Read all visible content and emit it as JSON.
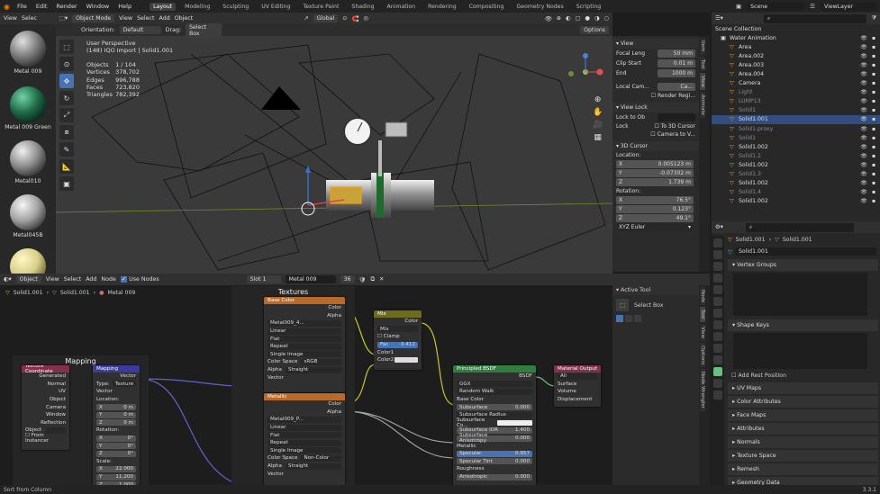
{
  "topbar": {
    "menus": [
      "File",
      "Edit",
      "Render",
      "Window",
      "Help"
    ],
    "workspaces": [
      "Layout",
      "Modeling",
      "Sculpting",
      "UV Editing",
      "Texture Paint",
      "Shading",
      "Animation",
      "Rendering",
      "Compositing",
      "Geometry Nodes",
      "Scripting"
    ],
    "active_workspace": "Layout",
    "scene": "Scene",
    "view_layer": "ViewLayer"
  },
  "assets": [
    {
      "name": "Metal 009",
      "color": "#9a9a9a"
    },
    {
      "name": "Metal 009 Green",
      "color": "#1f6b4a"
    },
    {
      "name": "Metal010",
      "color": "#8c8c8c"
    },
    {
      "name": "Metal045B",
      "color": "#a3a3a3"
    },
    {
      "name": "",
      "color": "#d8d08a"
    }
  ],
  "asset_header": {
    "view": "View",
    "select": "Selec"
  },
  "viewport": {
    "mode": "Object Mode",
    "menus": [
      "View",
      "Select",
      "Add",
      "Object"
    ],
    "orientation_label": "Orientation:",
    "orientation": "Default",
    "drag_label": "Drag:",
    "drag": "Select Box",
    "transform": "Global",
    "options": "Options",
    "perspective": "User Perspective",
    "context": "(148) IQO Import | Solid1.001",
    "stats": [
      {
        "k": "Objects",
        "v": "1 / 104"
      },
      {
        "k": "Vertices",
        "v": "378,702"
      },
      {
        "k": "Edges",
        "v": "996,788"
      },
      {
        "k": "Faces",
        "v": "723,820"
      },
      {
        "k": "Triangles",
        "v": "782,392"
      }
    ]
  },
  "npanel": {
    "view_title": "View",
    "focal_label": "Focal Leng",
    "focal": "50 mm",
    "clip_label": "Clip Start",
    "clip_start": "0.01 m",
    "end_label": "End",
    "clip_end": "1000 m",
    "local_cam": "Local Cam...",
    "cam_btn": "Ca...",
    "render_region": "Render Regi...",
    "view_lock_title": "View Lock",
    "lock_to_obj": "Lock to Ob",
    "lock_label": "Lock",
    "to_3d_cursor": "To 3D Cursor",
    "camera_to_view": "Camera to V...",
    "cursor_title": "3D Cursor",
    "location_label": "Location:",
    "loc": [
      {
        "a": "X",
        "v": "0.005123 m"
      },
      {
        "a": "Y",
        "v": "-0.07302 m"
      },
      {
        "a": "Z",
        "v": "1.739 m"
      }
    ],
    "rotation_label": "Rotation:",
    "rot": [
      {
        "a": "X",
        "v": "76.5°"
      },
      {
        "a": "Y",
        "v": "0.123°"
      },
      {
        "a": "Z",
        "v": "49.1°"
      }
    ],
    "euler": "XYZ Euler"
  },
  "vtabs": [
    "Item",
    "Tool",
    "View",
    "Animate"
  ],
  "outliner": {
    "collection": "Scene Collection",
    "rows": [
      {
        "name": "Water Animation",
        "sel": false,
        "dim": false
      },
      {
        "name": "Area",
        "sel": false,
        "dim": false
      },
      {
        "name": "Area.002",
        "sel": false,
        "dim": false
      },
      {
        "name": "Area.003",
        "sel": false,
        "dim": false
      },
      {
        "name": "Area.004",
        "sel": false,
        "dim": false
      },
      {
        "name": "Camera",
        "sel": false,
        "dim": false
      },
      {
        "name": "Light",
        "sel": false,
        "dim": true
      },
      {
        "name": "LUMP13",
        "sel": false,
        "dim": true
      },
      {
        "name": "Solid1",
        "sel": false,
        "dim": true
      },
      {
        "name": "Solid1.001",
        "sel": true,
        "dim": false
      },
      {
        "name": "Solid1.proxy",
        "sel": false,
        "dim": true
      },
      {
        "name": "Solid1",
        "sel": false,
        "dim": true
      },
      {
        "name": "Solid1.002",
        "sel": false,
        "dim": false
      },
      {
        "name": "Solid1.2",
        "sel": false,
        "dim": true
      },
      {
        "name": "Solid1.002",
        "sel": false,
        "dim": false
      },
      {
        "name": "Solid1.3",
        "sel": false,
        "dim": true
      },
      {
        "name": "Solid1.002",
        "sel": false,
        "dim": false
      },
      {
        "name": "Solid1.4",
        "sel": false,
        "dim": true
      },
      {
        "name": "Solid1.002",
        "sel": false,
        "dim": false
      }
    ]
  },
  "props": {
    "breadcrumb_a": "Solid1.001",
    "breadcrumb_b": "Solid1.001",
    "mesh_name": "Solid1.001",
    "vertex_groups": "Vertex Groups",
    "shape_keys": "Shape Keys",
    "add_rest": "Add Rest Position",
    "sections": [
      "UV Maps",
      "Color Attributes",
      "Face Maps",
      "Attributes",
      "Normals",
      "Texture Space",
      "Remesh",
      "Geometry Data"
    ]
  },
  "node_editor": {
    "type": "Object",
    "menus": [
      "View",
      "Select",
      "Add",
      "Node"
    ],
    "use_nodes": "Use Nodes",
    "slot": "Slot 1",
    "material": "Metal 009",
    "users": "36",
    "breadcrumb": [
      "Solid1.001",
      "Solid1.001",
      "Metal 009"
    ],
    "frame_mapping": "Mapping",
    "frame_textures": "Textures",
    "tex_coord": {
      "title": "Texture Coordinate",
      "outs": [
        "Generated",
        "Normal",
        "UV",
        "Object",
        "Camera",
        "Window",
        "Reflection"
      ],
      "object": "Object",
      "from_instancer": "From Instancer"
    },
    "mapping": {
      "title": "Mapping",
      "vector": "Vector",
      "type_label": "Type:",
      "type": "Texture",
      "vec_in": "Vector",
      "location": "Location:",
      "loc": [
        {
          "a": "X",
          "v": "0 m"
        },
        {
          "a": "Y",
          "v": "0 m"
        },
        {
          "a": "Z",
          "v": "0 m"
        }
      ],
      "rotation": "Rotation:",
      "rot": [
        {
          "a": "X",
          "v": "0°"
        },
        {
          "a": "Y",
          "v": "0°"
        },
        {
          "a": "Z",
          "v": "0°"
        }
      ],
      "scale": "Scale:",
      "scl": [
        {
          "a": "X",
          "v": "22.000"
        },
        {
          "a": "Y",
          "v": "11.200"
        },
        {
          "a": "Z",
          "v": "1.000"
        }
      ]
    },
    "base_color": {
      "title": "Base Color",
      "color": "Color",
      "alpha": "Alpha",
      "image": "Metal009_4...",
      "interp": "Linear",
      "proj": "Flat",
      "ext": "Repeat",
      "src": "Single Image",
      "cs_label": "Color Space",
      "cs": "sRGB",
      "alpha_label": "Alpha",
      "alpha_mode": "Straight",
      "vector": "Vector"
    },
    "metallic": {
      "title": "Metallic",
      "color": "Color",
      "alpha": "Alpha",
      "image": "Metal009_P...",
      "interp": "Linear",
      "proj": "Flat",
      "ext": "Repeat",
      "src": "Single Image",
      "cs_label": "Color Space",
      "cs": "Non-Color",
      "alpha_label": "Alpha",
      "alpha_mode": "Straight",
      "vector": "Vector"
    },
    "mix": {
      "title": "Mix",
      "color": "Color",
      "mode": "Mix",
      "clamp": "Clamp",
      "fac": "Fac",
      "fac_val": "0.412",
      "c1": "Color1",
      "c2": "Color2"
    },
    "bsdf": {
      "title": "Principled BSDF",
      "bsdf": "BSDF",
      "dist": "GGX",
      "sss": "Random Walk",
      "base": "Base Color",
      "subsurface": "Subsurface",
      "sub_val": "0.000",
      "sub_radius": "Subsurface Radius",
      "sub_color": "Subsurface Co...",
      "sub_ior": "Subsurface IOR",
      "sub_ior_val": "1.400",
      "sub_aniso": "Subsurface Anisotropy",
      "sub_aniso_val": "0.000",
      "metallic": "Metallic",
      "specular": "Specular",
      "spec_val": "0.957",
      "spec_tint": "Specular Tint",
      "spec_tint_val": "0.000",
      "roughness": "Roughness",
      "aniso": "Anisotropic",
      "aniso_val": "0.000"
    },
    "output": {
      "title": "Material Output",
      "target": "All",
      "surface": "Surface",
      "volume": "Volume",
      "displacement": "Displacement"
    }
  },
  "ne_npanel": {
    "title": "Active Tool",
    "tool": "Select Box"
  },
  "ne_vtabs": [
    "Node",
    "Tool",
    "View",
    "Options",
    "Node Wrangler"
  ],
  "status": {
    "left": "Sort from Column",
    "right": "3.3.1"
  }
}
